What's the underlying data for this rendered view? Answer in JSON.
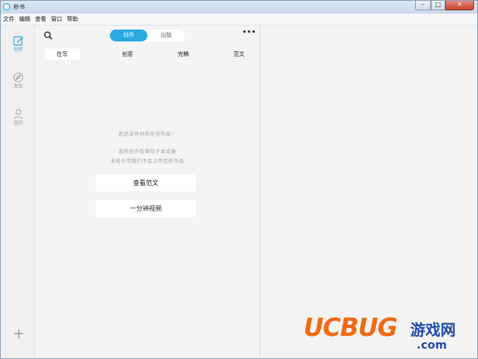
{
  "window": {
    "title": "秒书"
  },
  "menu": [
    "文件",
    "编辑",
    "查看",
    "窗口",
    "帮助"
  ],
  "sidebar": {
    "items": [
      {
        "label": "创作",
        "icon": "edit-icon"
      },
      {
        "label": "发现",
        "icon": "compass-icon"
      },
      {
        "label": "我的",
        "icon": "user-icon"
      }
    ],
    "add_icon": "+"
  },
  "panel": {
    "segment": {
      "active": "创作",
      "inactive": "出版"
    },
    "more": "•••",
    "tabs": [
      "在写",
      "创意",
      "完稿",
      "范文"
    ],
    "empty": {
      "line1": "您还没有创作任何作品！",
      "line2": "您的创作仅保存于本设备",
      "line3": "未经许可我们不会上传您的作品"
    },
    "buttons": {
      "view_samples": "查看范文",
      "one_minute_video": "一分钟视频"
    }
  },
  "watermark": {
    "brand": "UCBUG",
    "cn": "游戏网",
    "domain": ".com"
  },
  "colors": {
    "accent": "#2aa9e0",
    "watermark_orange": "#f06a14",
    "watermark_blue": "#1e4aa6"
  }
}
